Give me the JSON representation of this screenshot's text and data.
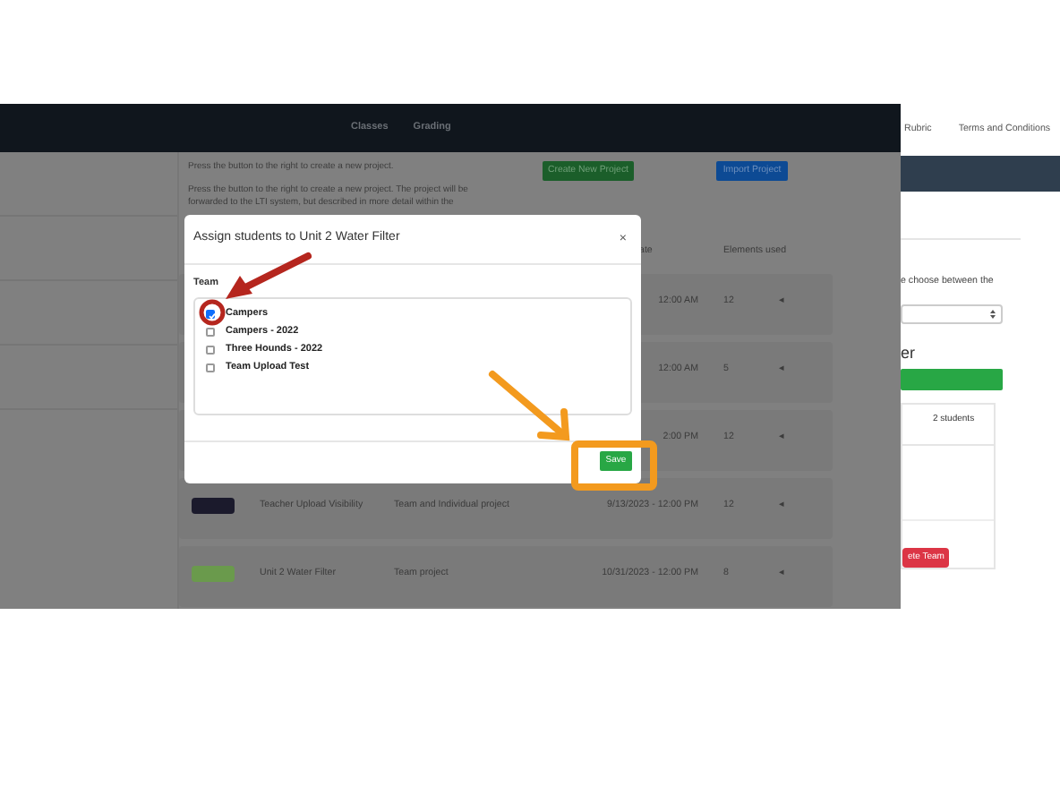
{
  "left_screen": {
    "navbar": {
      "links": [
        "Classes",
        "Grading"
      ]
    },
    "intro": "Press the button to the right to create a new project.",
    "description": [
      "Press the button to the right to create a new project. The project will be",
      "forwarded to the LTI system, but described in more detail within the"
    ],
    "buttons": [
      {
        "label": "Create New Project",
        "kind": "success"
      },
      {
        "label": "Import Project",
        "kind": "primary"
      }
    ],
    "table": {
      "columns": [
        "ate",
        "Elements used"
      ],
      "rows": [
        {
          "date": "12:00 AM",
          "elements": "12",
          "caret": "◂"
        },
        {
          "date": "12:00 AM",
          "elements": "5",
          "caret": "◂"
        },
        {
          "date": "2:00 PM",
          "elements": "12",
          "caret": "◂"
        },
        {
          "color": "#1b1a2c",
          "name": "Teacher Upload Visibility",
          "type": "Team and Individual project",
          "date": "9/13/2023 - 12:00 PM",
          "elements": "12",
          "caret": "◂"
        },
        {
          "color": "#6a9a4c",
          "name": "Unit 2 Water Filter",
          "type": "Team project",
          "date": "10/31/2023 - 12:00 PM",
          "elements": "8",
          "caret": "◂"
        }
      ]
    }
  },
  "modal": {
    "title": "Assign students to Unit 2 Water Filter",
    "close": "×",
    "label": "Team",
    "teams": [
      {
        "name": "Campers",
        "checked": true
      },
      {
        "name": "Campers - 2022",
        "checked": false
      },
      {
        "name": "Three Hounds - 2022",
        "checked": false
      },
      {
        "name": "Team Upload Test",
        "checked": false
      }
    ],
    "save": "Save"
  },
  "right_screen": {
    "nav_links": [
      "Rubric",
      "Terms and Conditions"
    ],
    "instruction": "e choose between the",
    "heading": "er",
    "team_count": "2 students",
    "delete_button": "ete Team"
  }
}
